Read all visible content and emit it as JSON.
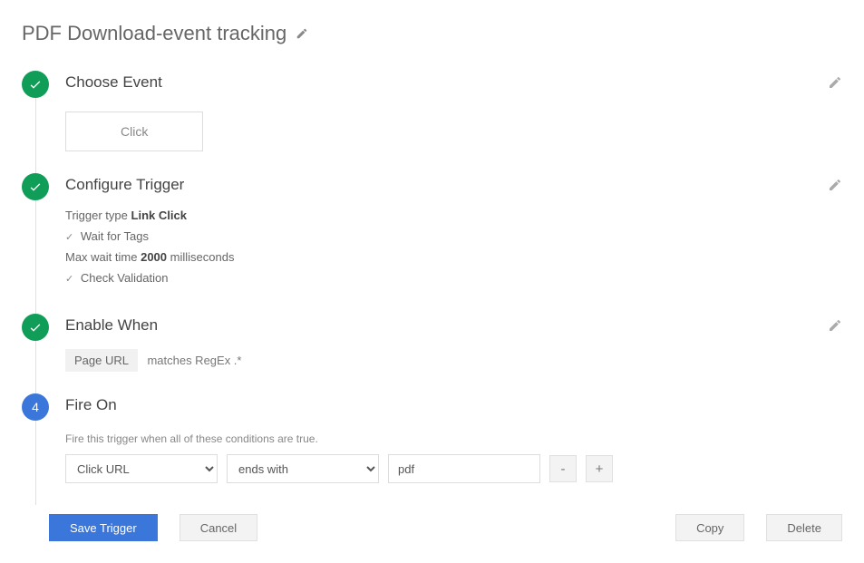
{
  "title": "PDF Download-event tracking",
  "steps": {
    "choose_event": {
      "title": "Choose Event",
      "button_label": "Click"
    },
    "configure_trigger": {
      "title": "Configure Trigger",
      "type_label": "Trigger type",
      "type_value": "Link Click",
      "wait_for_tags": "Wait for Tags",
      "max_wait_prefix": "Max wait time",
      "max_wait_value": "2000",
      "max_wait_suffix": "milliseconds",
      "check_validation": "Check Validation"
    },
    "enable_when": {
      "title": "Enable When",
      "chip": "Page URL",
      "text": "matches RegEx .*"
    },
    "fire_on": {
      "number": "4",
      "title": "Fire On",
      "hint": "Fire this trigger when all of these conditions are true.",
      "var_select": "Click URL",
      "op_select": "ends with",
      "value_input": "pdf",
      "minus": "-",
      "plus": "+"
    }
  },
  "footer": {
    "save": "Save Trigger",
    "cancel": "Cancel",
    "copy": "Copy",
    "delete": "Delete"
  }
}
